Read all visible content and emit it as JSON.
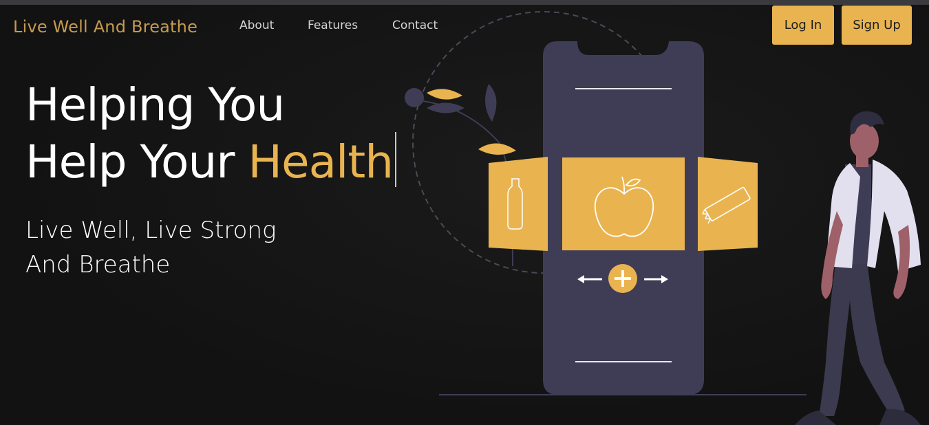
{
  "nav": {
    "brand": "Live Well And Breathe",
    "links": [
      "About",
      "Features",
      "Contact"
    ],
    "login_label": "Log In",
    "signup_label": "Sign Up"
  },
  "hero": {
    "title_line1": "Helping You",
    "title_line2_prefix": "Help Your ",
    "title_line2_accent": "Health",
    "subtitle_line1": "Live Well, Live Strong",
    "subtitle_line2": "And Breathe"
  },
  "colors": {
    "background": "#141414",
    "accent": "#e9b450",
    "brand_text": "#c59b50",
    "phone": "#3f3d56"
  },
  "icons": [
    "water-bottle-icon",
    "apple-icon",
    "snack-bar-icon",
    "plus-icon",
    "arrow-left-icon",
    "arrow-right-icon"
  ]
}
